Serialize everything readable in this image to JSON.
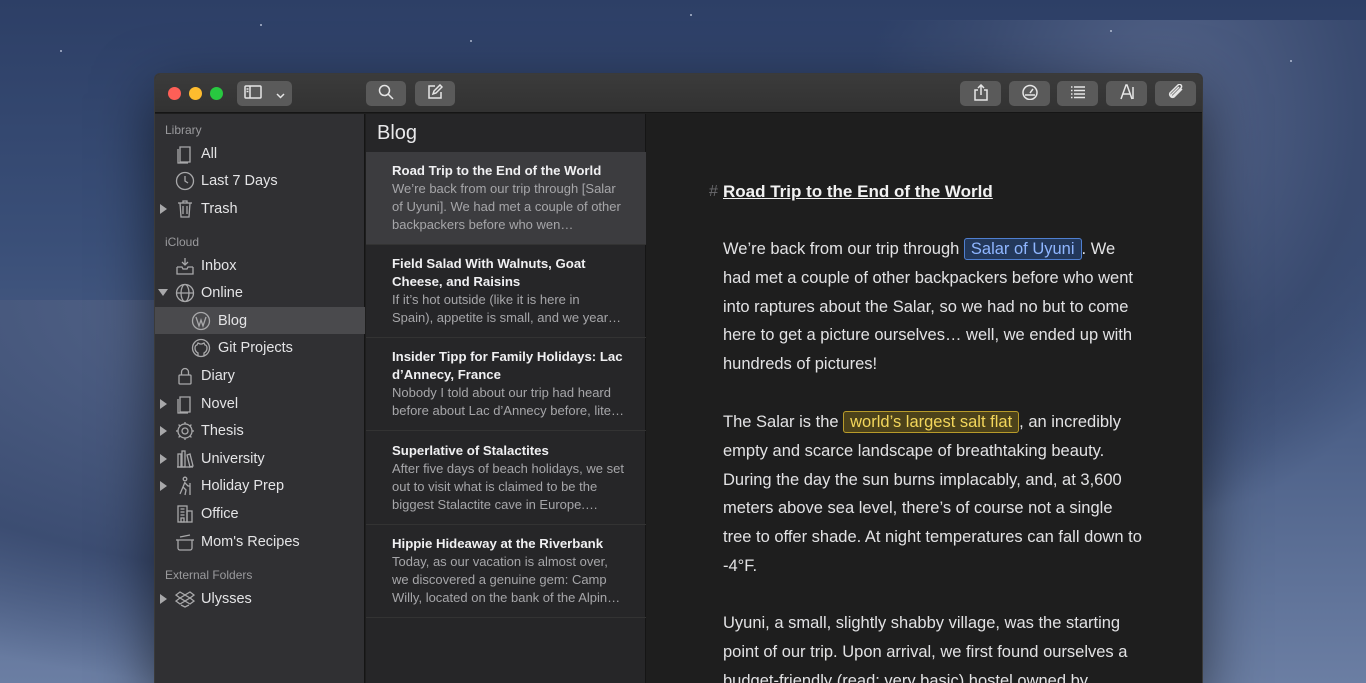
{
  "toolbar": {
    "sidebar_toggle_icon": "sidebar-icon",
    "dropdown_icon": "chevron-down-icon",
    "search_icon": "search-icon",
    "compose_icon": "compose-icon",
    "share_icon": "share-icon",
    "goals_icon": "gauge-icon",
    "outline_icon": "list-icon",
    "typography_icon": "typography-icon",
    "attach_icon": "paperclip-icon"
  },
  "sidebar": {
    "library_label": "Library",
    "library_items": [
      {
        "label": "All",
        "icon": "sheets-icon"
      },
      {
        "label": "Last 7 Days",
        "icon": "clock-icon"
      },
      {
        "label": "Trash",
        "icon": "trash-icon"
      }
    ],
    "icloud_label": "iCloud",
    "icloud_items": [
      {
        "label": "Inbox",
        "icon": "inbox-icon"
      },
      {
        "label": "Online",
        "icon": "globe-icon"
      },
      {
        "label": "Blog",
        "icon": "wordpress-icon"
      },
      {
        "label": "Git Projects",
        "icon": "github-icon"
      },
      {
        "label": "Diary",
        "icon": "lock-icon"
      },
      {
        "label": "Novel",
        "icon": "book-icon"
      },
      {
        "label": "Thesis",
        "icon": "gear-icon"
      },
      {
        "label": "University",
        "icon": "library-icon"
      },
      {
        "label": "Holiday Prep",
        "icon": "hiker-icon"
      },
      {
        "label": "Office",
        "icon": "building-icon"
      },
      {
        "label": "Mom's Recipes",
        "icon": "pot-icon"
      }
    ],
    "external_label": "External Folders",
    "external_items": [
      {
        "label": "Ulysses",
        "icon": "dropbox-icon"
      }
    ]
  },
  "list": {
    "title": "Blog",
    "sheets": [
      {
        "title": "Road Trip to the End of the World",
        "excerpt": "We’re back from our trip through [Salar of Uyuni]. We had met a couple of other backpackers before who wen…"
      },
      {
        "title": "Field Salad With Walnuts, Goat Cheese, and Raisins",
        "excerpt": "If it’s hot outside (like it is here in Spain), appetite is small, and we year…"
      },
      {
        "title": "Insider Tipp for Family Holidays: Lac d’Annecy, France",
        "excerpt": "Nobody I told about our trip had heard before about Lac d’Annecy before, lite…"
      },
      {
        "title": "Superlative of Stalactites",
        "excerpt": "After five days of beach holidays, we set out to visit what is claimed to be the biggest Stalactite cave in Europe.…"
      },
      {
        "title": "Hippie Hideaway at the Riverbank",
        "excerpt": "Today, as our vacation is almost over, we discovered a genuine gem: Camp Willy, located on the bank of the Alpin…"
      }
    ]
  },
  "editor": {
    "hash": "#",
    "heading": "Road Trip to the End of the World",
    "p1_before": "We’re back from our trip through ",
    "p1_link": "Salar of Uyuni",
    "p1_after": ". We had met a couple of other backpackers before who went into raptures about the Salar, so we had no but to come here to get a picture ourselves… well, we ended up with hundreds of pictures!",
    "p2_before": "The Salar is the ",
    "p2_mark": "world’s largest salt flat",
    "p2_after": ", an incredibly empty and scarce landscape of breathtaking beauty. During the day the sun burns implacably, and, at 3,600 meters above sea level, there’s of course not a single tree to offer shade. At night temperatures can fall down to -4°F.",
    "p3": "Uyuni, a small, slightly shabby village, was the starting point of our trip. Upon arrival, we first found ourselves a budget-friendly (read: very basic) hostel owned by"
  }
}
